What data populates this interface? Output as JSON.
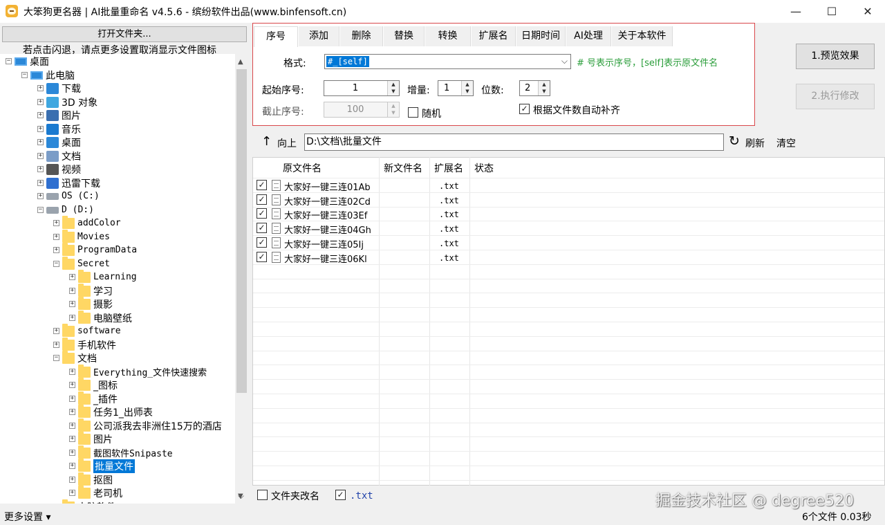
{
  "window": {
    "title": "大笨狗更名器 | AI批量重命名 v4.5.6 - 缤纷软件出品(www.binfensoft.cn)",
    "minimize_glyph": "—",
    "maximize_glyph": "☐",
    "close_glyph": "✕"
  },
  "left": {
    "open_folder_label": "打开文件夹...",
    "hint": "若点击闪退，请点更多设置取消显示文件图标",
    "tree": {
      "desktop": "桌面",
      "this_pc": "此电脑",
      "pc_items": [
        "下载",
        "3D 对象",
        "图片",
        "音乐",
        "桌面",
        "文档",
        "视频",
        "迅雷下载",
        "OS (C:)",
        "D (D:)"
      ],
      "d_items": [
        "addColor",
        "Movies",
        "ProgramData",
        "Secret"
      ],
      "secret_items": [
        "Learning",
        "学习",
        "摄影",
        "电脑壁纸"
      ],
      "d_items2": [
        "software",
        "手机软件",
        "文档"
      ],
      "docs_items": [
        "Everything_文件快速搜索",
        "_图标",
        "_插件",
        "任务1_出师表",
        "公司派我去非洲住15万的酒店",
        "图片",
        "截图软件Snipaste",
        "批量文件",
        "抠图",
        "老司机"
      ],
      "last_item": "电脑软件"
    }
  },
  "tabs": [
    "序号",
    "添加",
    "删除",
    "替换",
    "转换",
    "扩展名",
    "日期时间",
    "AI处理",
    "关于本软件"
  ],
  "serial": {
    "format_label": "格式:",
    "format_value": "#_[self]",
    "format_hint": "# 号表示序号，[self]表示原文件名",
    "start_label": "起始序号:",
    "start_value": "1",
    "step_label": "增量:",
    "step_value": "1",
    "digits_label": "位数:",
    "digits_value": "2",
    "end_label": "截止序号:",
    "end_value": "100",
    "random_label": "随机",
    "random_checked": false,
    "autopad_label": "根据文件数自动补齐",
    "autopad_checked": true
  },
  "actions": {
    "preview_label": "1.预览效果",
    "execute_label": "2.执行修改"
  },
  "pathbar": {
    "up_label": "向上",
    "path": "D:\\文档\\批量文件",
    "refresh_label": "刷新",
    "clear_label": "清空"
  },
  "table": {
    "columns": [
      "原文件名",
      "新文件名",
      "扩展名",
      "状态"
    ],
    "rows": [
      {
        "checked": true,
        "name": "大家好一键三连01Ab",
        "new_name": "",
        "ext": ".txt",
        "status": ""
      },
      {
        "checked": true,
        "name": "大家好一键三连02Cd",
        "new_name": "",
        "ext": ".txt",
        "status": ""
      },
      {
        "checked": true,
        "name": "大家好一键三连03Ef",
        "new_name": "",
        "ext": ".txt",
        "status": ""
      },
      {
        "checked": true,
        "name": "大家好一键三连04Gh",
        "new_name": "",
        "ext": ".txt",
        "status": ""
      },
      {
        "checked": true,
        "name": "大家好一键三连05Ij",
        "new_name": "",
        "ext": ".txt",
        "status": ""
      },
      {
        "checked": true,
        "name": "大家好一键三连06Kl",
        "new_name": "",
        "ext": ".txt",
        "status": ""
      }
    ]
  },
  "bottom": {
    "folder_rename_label": "文件夹改名",
    "folder_rename_checked": false,
    "ext_filter_label": ".txt",
    "ext_filter_checked": true
  },
  "status": {
    "more_settings": "更多设置 ▾",
    "summary": "6个文件  0.03秒"
  },
  "watermark": "掘金技术社区 @ degree520",
  "colors": {
    "accent": "#0078d7",
    "tab_panel_border": "#d9464a",
    "hint_green": "#2a9d3a",
    "folder": "#ffd764"
  }
}
